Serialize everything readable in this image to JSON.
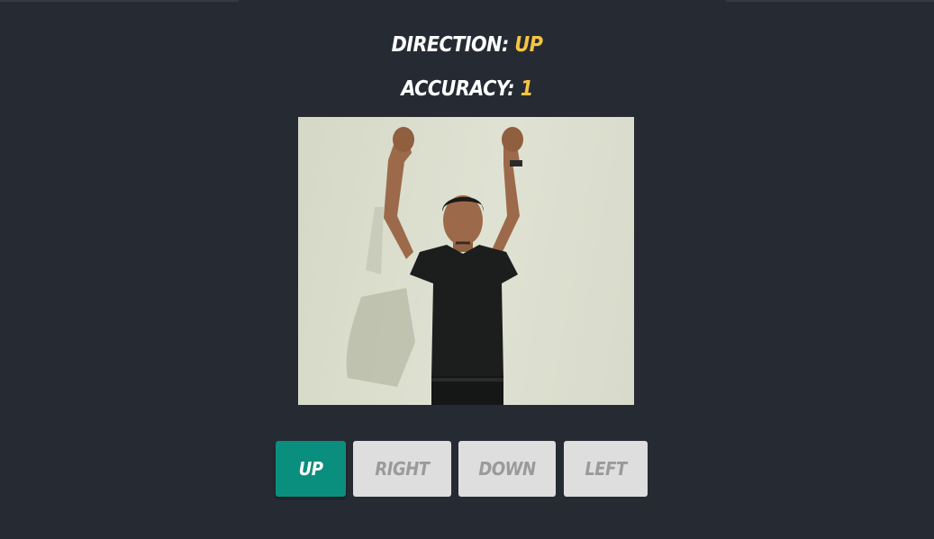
{
  "status": {
    "direction_label": "Direction:",
    "direction_value": "UP",
    "accuracy_label": "Accuracy:",
    "accuracy_value": "1"
  },
  "colors": {
    "background": "#262a33",
    "value_accent": "#f5c542",
    "active_button": "#0a8f7e",
    "inactive_button": "#dedede"
  },
  "buttons": [
    {
      "label": "UP",
      "active": true
    },
    {
      "label": "RIGHT",
      "active": false
    },
    {
      "label": "DOWN",
      "active": false
    },
    {
      "label": "LEFT",
      "active": false
    }
  ]
}
